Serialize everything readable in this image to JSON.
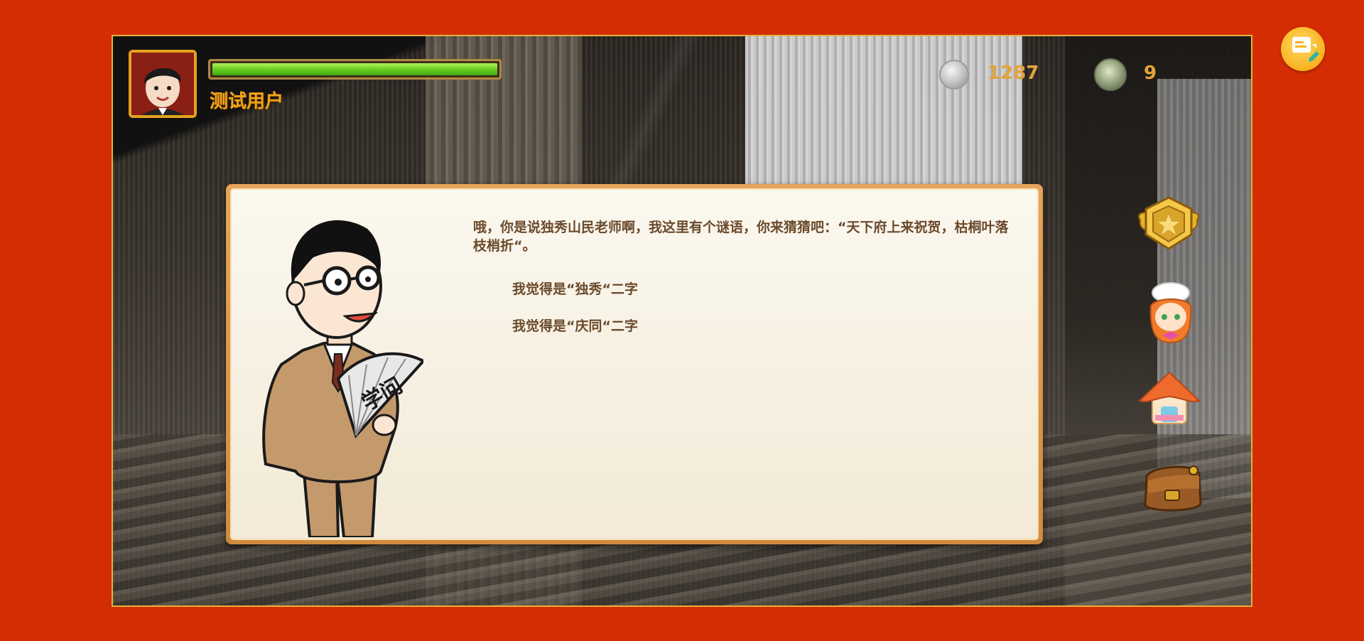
{
  "player": {
    "name": "测试用户",
    "hp_fraction": 1.0
  },
  "currency": {
    "coins": "1287",
    "tickets": "9"
  },
  "dialog": {
    "npc_fan_text": "学问",
    "message": "哦，你是说独秀山民老师啊，我这里有个谜语，你来猜猜吧：“天下府上来祝贺，枯桐叶落枝梢折“。",
    "options": [
      "我觉得是“独秀“二字",
      "我觉得是“庆同“二字"
    ]
  },
  "icons": {
    "avatar": "player-avatar-icon",
    "coin": "silver-coin-icon",
    "ticket": "ticket-coin-icon",
    "chat": "chat-bubble-icon",
    "achievement": "badge-medal-icon",
    "character": "chef-girl-icon",
    "house": "house-icon",
    "bag": "backpack-icon"
  },
  "colors": {
    "background": "#d52d03",
    "frame_border": "#e4b23a",
    "hp_green": "#6ed324",
    "username": "#f2a41d",
    "currency_text": "#e2a33c",
    "dialog_text": "#6b4a2c",
    "dialog_border": "#d08a3e"
  }
}
